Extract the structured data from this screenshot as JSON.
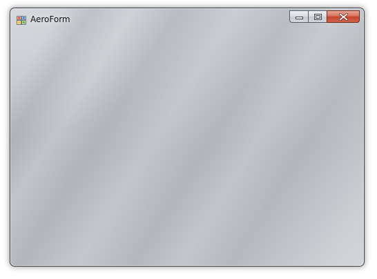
{
  "window": {
    "title": "AeroForm",
    "icon": "winforms-app-icon"
  },
  "caption_buttons": {
    "minimize_icon": "minimize-icon",
    "maximize_icon": "maximize-icon",
    "close_icon": "close-icon"
  },
  "colors": {
    "glass_background": "#bfc3c8",
    "close_button": "#c3452e",
    "title_text": "#111111"
  }
}
